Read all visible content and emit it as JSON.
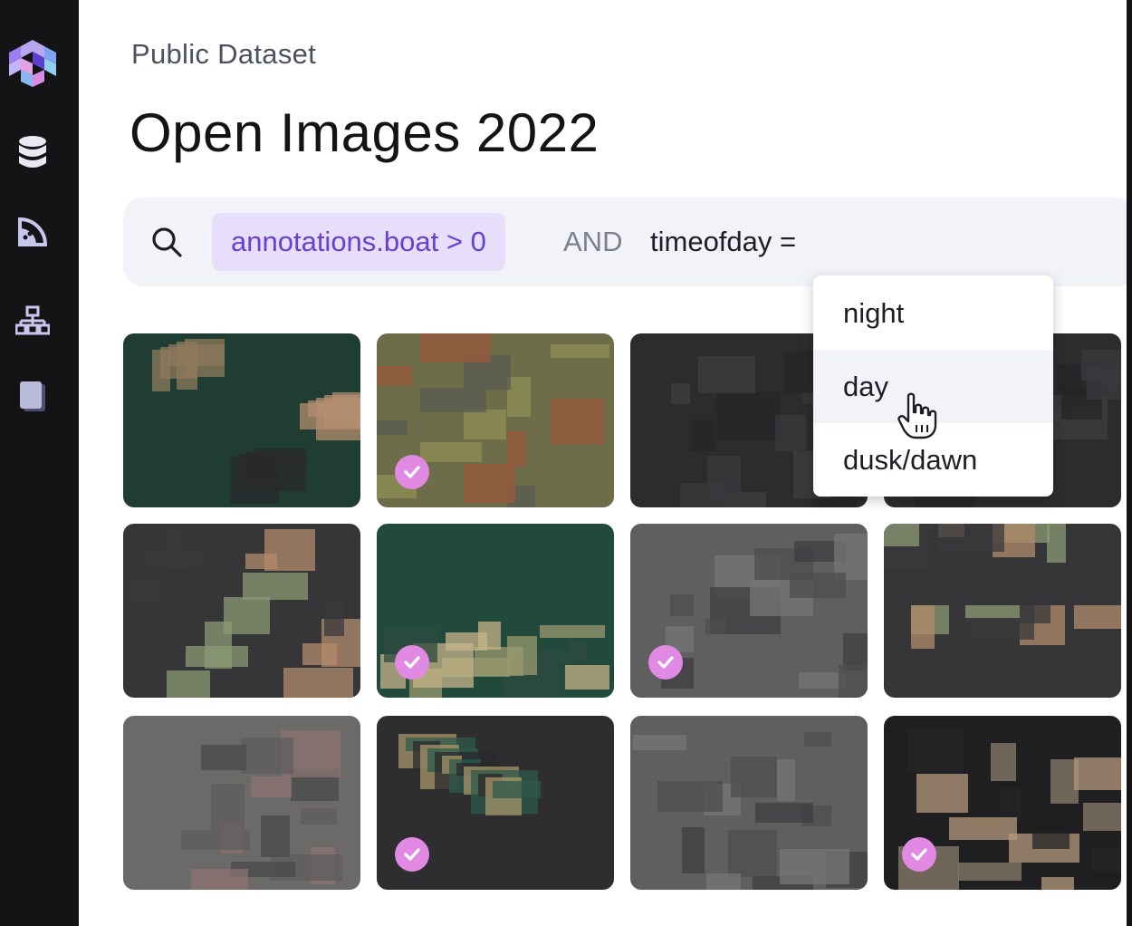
{
  "sidebar": {
    "items": [
      {
        "name": "logo-icon"
      },
      {
        "name": "database-icon"
      },
      {
        "name": "pie-chart-icon"
      },
      {
        "name": "network-icon"
      },
      {
        "name": "notebook-icon"
      }
    ]
  },
  "header": {
    "eyebrow": "Public Dataset",
    "title": "Open Images 2022"
  },
  "search": {
    "icon": "search-icon",
    "chip": "annotations.boat > 0",
    "operator": "AND",
    "field": "timeofday ="
  },
  "dropdown": {
    "options": [
      "night",
      "day",
      "dusk/dawn"
    ],
    "hovered": "day"
  },
  "grid": {
    "thumbnails": [
      {
        "selected": false,
        "theme": "harbor"
      },
      {
        "selected": true,
        "theme": "terrain"
      },
      {
        "selected": false,
        "theme": "dark-sea"
      },
      {
        "selected": false,
        "theme": "dark-sea"
      },
      {
        "selected": false,
        "theme": "coast-left"
      },
      {
        "selected": true,
        "theme": "green-bay"
      },
      {
        "selected": true,
        "theme": "gray-city"
      },
      {
        "selected": false,
        "theme": "coast-left"
      },
      {
        "selected": false,
        "theme": "gray-terrain"
      },
      {
        "selected": true,
        "theme": "coast-green"
      },
      {
        "selected": false,
        "theme": "gray-city"
      },
      {
        "selected": true,
        "theme": "dark-beach"
      }
    ]
  },
  "colors": {
    "sidebar": "#141416",
    "chip_bg": "#e6defa",
    "chip_text": "#6b3fd4",
    "check": "#e08ae3",
    "searchbar": "#f1f3f8"
  }
}
